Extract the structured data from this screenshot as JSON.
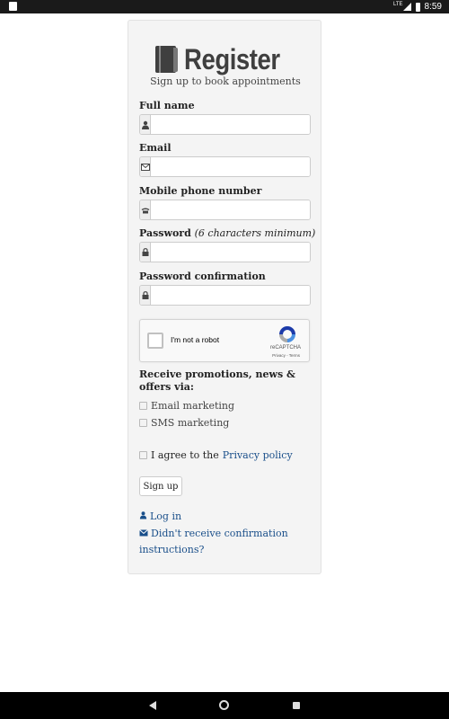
{
  "status_bar": {
    "time": "8:59",
    "network": "LTE"
  },
  "header": {
    "title": "Register",
    "subtitle": "Sign up to book appointments"
  },
  "form": {
    "full_name": {
      "label": "Full name",
      "value": "",
      "icon": "user-icon"
    },
    "email": {
      "label": "Email",
      "value": "",
      "icon": "envelope-icon"
    },
    "phone": {
      "label": "Mobile phone number",
      "value": "",
      "icon": "phone-icon"
    },
    "password": {
      "label": "Password",
      "hint": "(6 characters minimum)",
      "value": "",
      "icon": "lock-icon"
    },
    "password_confirmation": {
      "label": "Password confirmation",
      "value": "",
      "icon": "lock-icon"
    }
  },
  "recaptcha": {
    "label": "I'm not a robot",
    "brand": "reCAPTCHA",
    "terms": "Privacy - Terms"
  },
  "promotions": {
    "heading": "Receive promotions, news & offers via:",
    "options": [
      {
        "label": "Email marketing",
        "checked": false
      },
      {
        "label": "SMS marketing",
        "checked": false
      }
    ]
  },
  "agreement": {
    "prefix": "I agree to the",
    "link": "Privacy policy",
    "checked": false
  },
  "signup_button": "Sign up",
  "links": {
    "login": "Log in",
    "resend": "Didn't receive confirmation instructions?"
  },
  "colors": {
    "card_bg": "#f4f4f4",
    "link": "#1a4f8a",
    "title": "#3f3f3f"
  }
}
